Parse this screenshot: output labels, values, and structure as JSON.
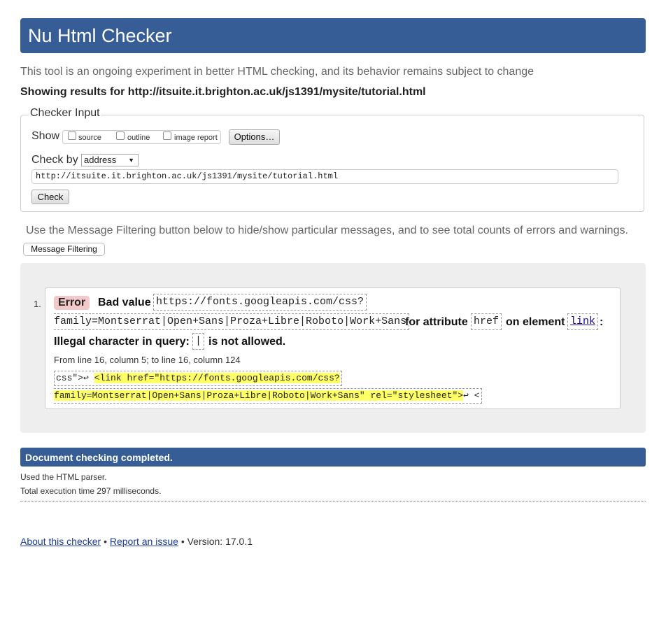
{
  "header": {
    "title": "Nu Html Checker"
  },
  "tagline": "This tool is an ongoing experiment in better HTML checking, and its behavior remains subject to change",
  "showing": "Showing results for http://itsuite.it.brighton.ac.uk/js1391/mysite/tutorial.html",
  "checker_input": {
    "legend": "Checker Input",
    "show_label": "Show",
    "options": [
      {
        "label": "source",
        "checked": false
      },
      {
        "label": "outline",
        "checked": false
      },
      {
        "label": "image report",
        "checked": false
      }
    ],
    "options_button": "Options…",
    "check_by_label": "Check by",
    "check_by_value": "address",
    "url_value": "http://itsuite.it.brighton.ac.uk/js1391/mysite/tutorial.html",
    "check_button": "Check"
  },
  "filter_note": "Use the Message Filtering button below to hide/show particular messages, and to see total counts of errors and warnings.",
  "filter_button": "Message Filtering",
  "message": {
    "number": "1.",
    "type": "Error",
    "text_bad_value": "Bad value",
    "value_line1": "https://fonts.googleapis.com/css?",
    "value_line2": "family=Montserrat|Open+Sans|Proza+Libre|Roboto|Work+Sans",
    "text_for_attribute": "for attribute",
    "attribute": "href",
    "text_on_element": "on element",
    "element": "link",
    "colon": ":",
    "text_illegal": "Illegal character in query:",
    "char": "|",
    "text_not_allowed": "is not allowed.",
    "location": "From line 16, column 5; to line 16, column 124",
    "extract_line1_pre": "css\">↩    ",
    "extract_line1_hl": "<link href=\"https://fonts.googleapis.com/css?",
    "extract_line2_hl": "family=Montserrat|Open+Sans|Proza+Libre|Roboto|Work+Sans\" rel=\"stylesheet\">",
    "extract_line2_post": "↩    <"
  },
  "status": {
    "title": "Document checking completed.",
    "parser": "Used the HTML parser.",
    "exec_time": "Total execution time 297 milliseconds."
  },
  "footer": {
    "about_link": "About this checker",
    "sep": "•",
    "report_link": "Report an issue",
    "version": "• Version: 17.0.1"
  },
  "colors": {
    "header_bg": "#365d95",
    "error_badge_bg": "#f2c8c8",
    "highlight": "#ffff66",
    "panel_bg": "#eeeeee"
  }
}
